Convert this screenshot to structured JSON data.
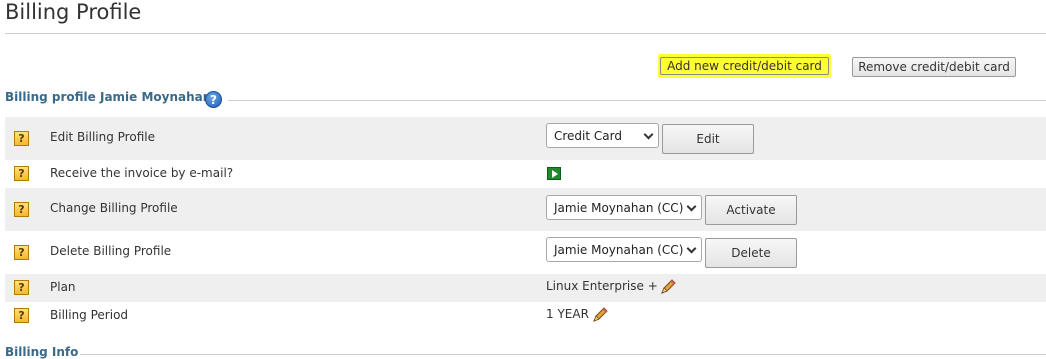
{
  "page": {
    "title": "Billing Profile"
  },
  "toolbar": {
    "add_card_label": "Add new credit/debit card",
    "remove_card_label": "Remove credit/debit card"
  },
  "profile_section": {
    "title": "Billing profile Jamie Moynahan",
    "help_icon": "?"
  },
  "rows": [
    {
      "label": "Edit Billing Profile",
      "select_value": "Credit Card",
      "button_label": "Edit"
    },
    {
      "label": "Receive the invoice by e-mail?",
      "icon": "play-toggle-icon"
    },
    {
      "label": "Change Billing Profile",
      "select_value": "Jamie Moynahan (CC)",
      "button_label": "Activate"
    },
    {
      "label": "Delete Billing Profile",
      "select_value": "Jamie Moynahan (CC)",
      "button_label": "Delete"
    },
    {
      "label": "Plan",
      "value": "Linux Enterprise +",
      "icon": "pencil-icon"
    },
    {
      "label": "Billing Period",
      "value": "1 YEAR",
      "icon": "pencil-icon"
    }
  ],
  "row_help_glyph": "?",
  "info_section": {
    "title": "Billing Info"
  },
  "colors": {
    "highlight": "#ffff33",
    "section_title": "#3a6a8a",
    "row_shade": "#efefef",
    "play_icon": "#1f8a2a"
  }
}
